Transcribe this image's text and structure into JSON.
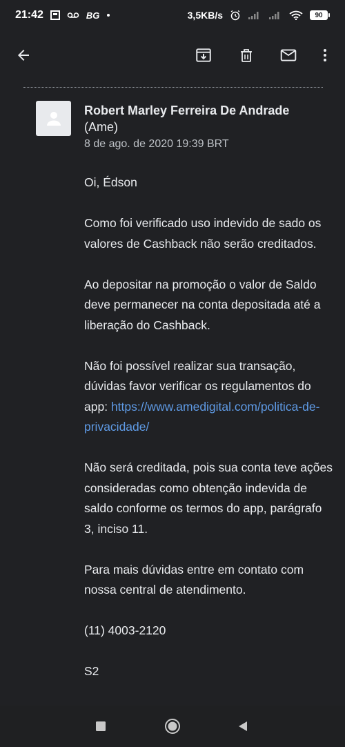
{
  "status_bar": {
    "time": "21:42",
    "carrier_tag": "BG",
    "net_speed": "3,5KB/s",
    "battery_level": "90",
    "icons": [
      "notification-square-icon",
      "voicemail-icon",
      "dot-icon",
      "alarm-icon",
      "signal-icon",
      "signal-icon-2",
      "wifi-icon",
      "battery-icon"
    ]
  },
  "toolbar": {
    "back": "back-arrow-icon",
    "archive": "archive-icon",
    "delete": "trash-icon",
    "mark_unread": "mail-icon",
    "more": "more-vert-icon"
  },
  "email": {
    "sender_name": "Robert Marley Ferreira De Andrade",
    "sender_org": "(Ame)",
    "date": "8 de ago. de 2020 19:39 BRT",
    "greeting": "Oi, Édson",
    "para1": "Como foi verificado uso indevido de sado os valores de Cashback não serão creditados.",
    "para2": "Ao depositar na promoção o valor de Saldo deve permanecer na conta depositada até a liberação do Cashback.",
    "para3_text": "Não foi possível realizar sua transação, dúvidas favor verificar os regulamentos do app: ",
    "para3_link": "https://www.amedigital.com/politica-de-privacidade/",
    "para4": "Não será creditada, pois sua conta teve ações consideradas como obtenção indevida de saldo conforme os termos do app, parágrafo 3, inciso 11.",
    "para5": "Para mais dúvidas entre em contato com nossa central de atendimento.",
    "phone": "(11) 4003-2120",
    "signoff": "S2"
  },
  "colors": {
    "background": "#202124",
    "text": "#e8eaed",
    "link": "#5f9be6",
    "secondary_text": "#bdc1c6"
  }
}
